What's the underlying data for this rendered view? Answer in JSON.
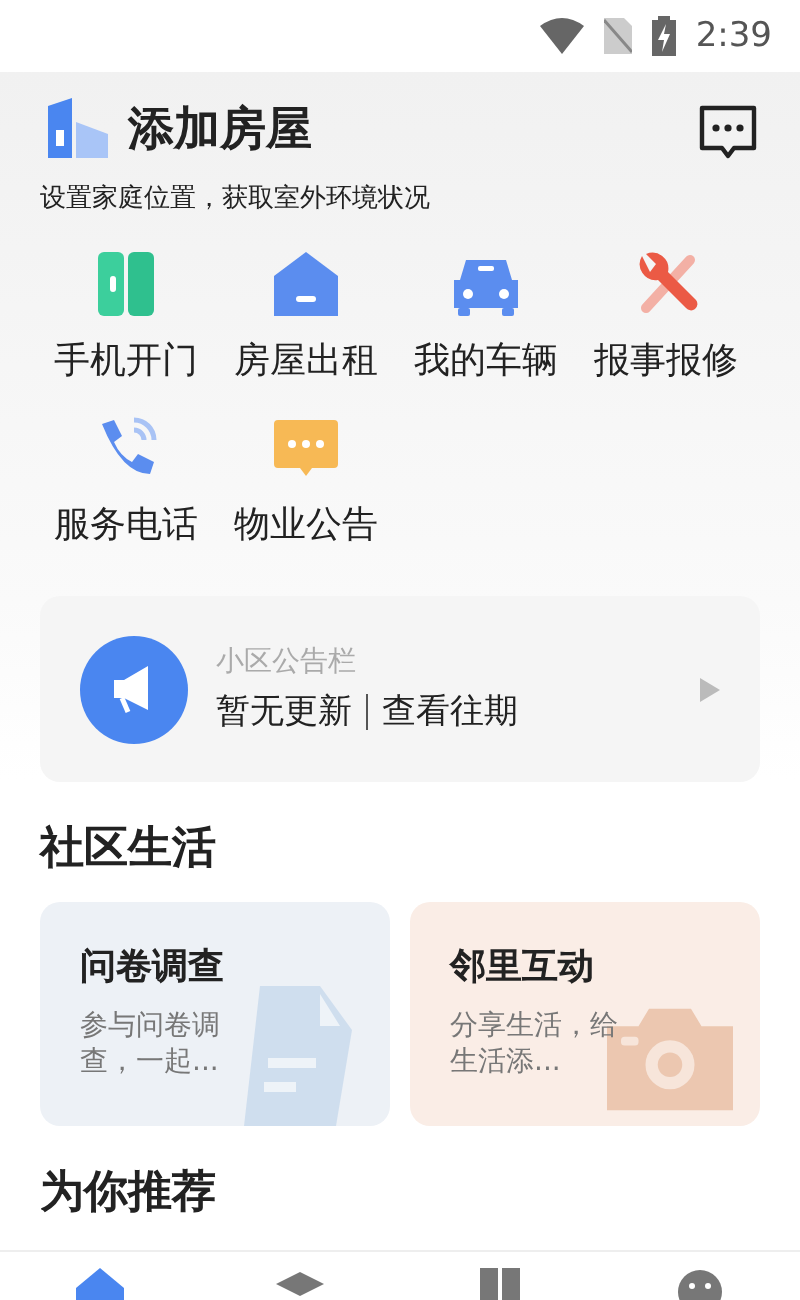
{
  "status_bar": {
    "time": "2:39"
  },
  "header": {
    "title": "添加房屋",
    "subtitle": "设置家庭位置，获取室外环境状况"
  },
  "services": [
    {
      "kind": "door",
      "label": "手机开门"
    },
    {
      "kind": "house",
      "label": "房屋出租"
    },
    {
      "kind": "car",
      "label": "我的车辆"
    },
    {
      "kind": "repair",
      "label": "报事报修"
    },
    {
      "kind": "phone",
      "label": "服务电话"
    },
    {
      "kind": "notice",
      "label": "物业公告"
    }
  ],
  "notice_board": {
    "title": "小区公告栏",
    "status": "暂无更新",
    "link": "查看往期"
  },
  "community": {
    "title": "社区生活",
    "cards": [
      {
        "kind": "survey",
        "title": "问卷调查",
        "description": "参与问卷调查，一起..."
      },
      {
        "kind": "social",
        "title": "邻里互动",
        "description": "分享生活，给生活添..."
      }
    ]
  },
  "recommend": {
    "title": "为你推荐"
  },
  "nav_tabs": [
    {
      "kind": "home",
      "selected": true
    },
    {
      "kind": "community",
      "selected": false
    },
    {
      "kind": "apps",
      "selected": false
    },
    {
      "kind": "profile",
      "selected": false
    }
  ]
}
